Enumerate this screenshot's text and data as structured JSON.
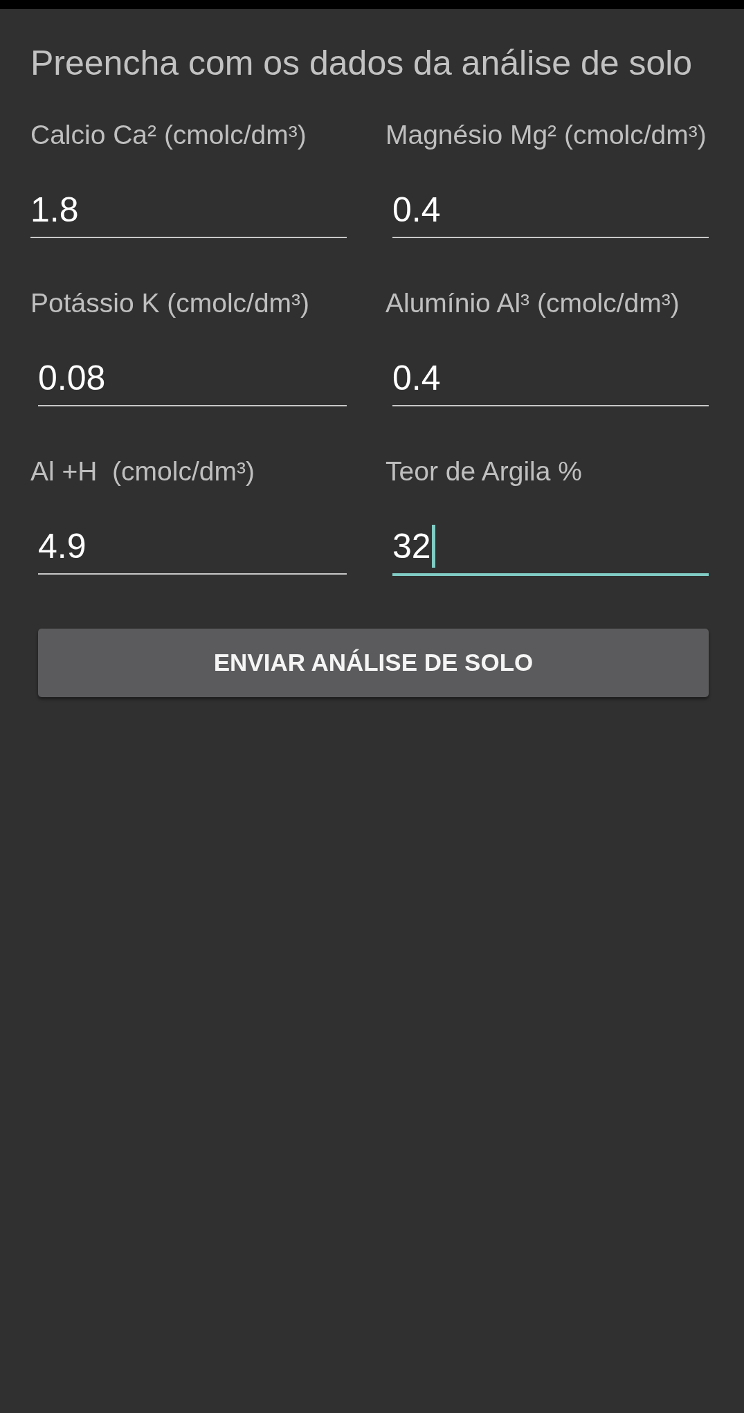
{
  "title": "Preencha com os dados da análise de solo",
  "fields": [
    {
      "label": "Calcio Ca² (cmolc/dm³)",
      "value": "1.8",
      "focused": false
    },
    {
      "label": "Magnésio Mg² (cmolc/dm³)",
      "value": "0.4",
      "focused": false
    },
    {
      "label": "Potássio K (cmolc/dm³)",
      "value": "0.08",
      "focused": false
    },
    {
      "label": "Alumínio Al³ (cmolc/dm³)",
      "value": "0.4",
      "focused": false
    },
    {
      "label": "Al +H  (cmolc/dm³)",
      "value": "4.9",
      "focused": false
    },
    {
      "label": "Teor de Argila %",
      "value": "32",
      "focused": true
    }
  ],
  "button": {
    "label": "ENVIAR ANÁLISE DE SOLO"
  }
}
